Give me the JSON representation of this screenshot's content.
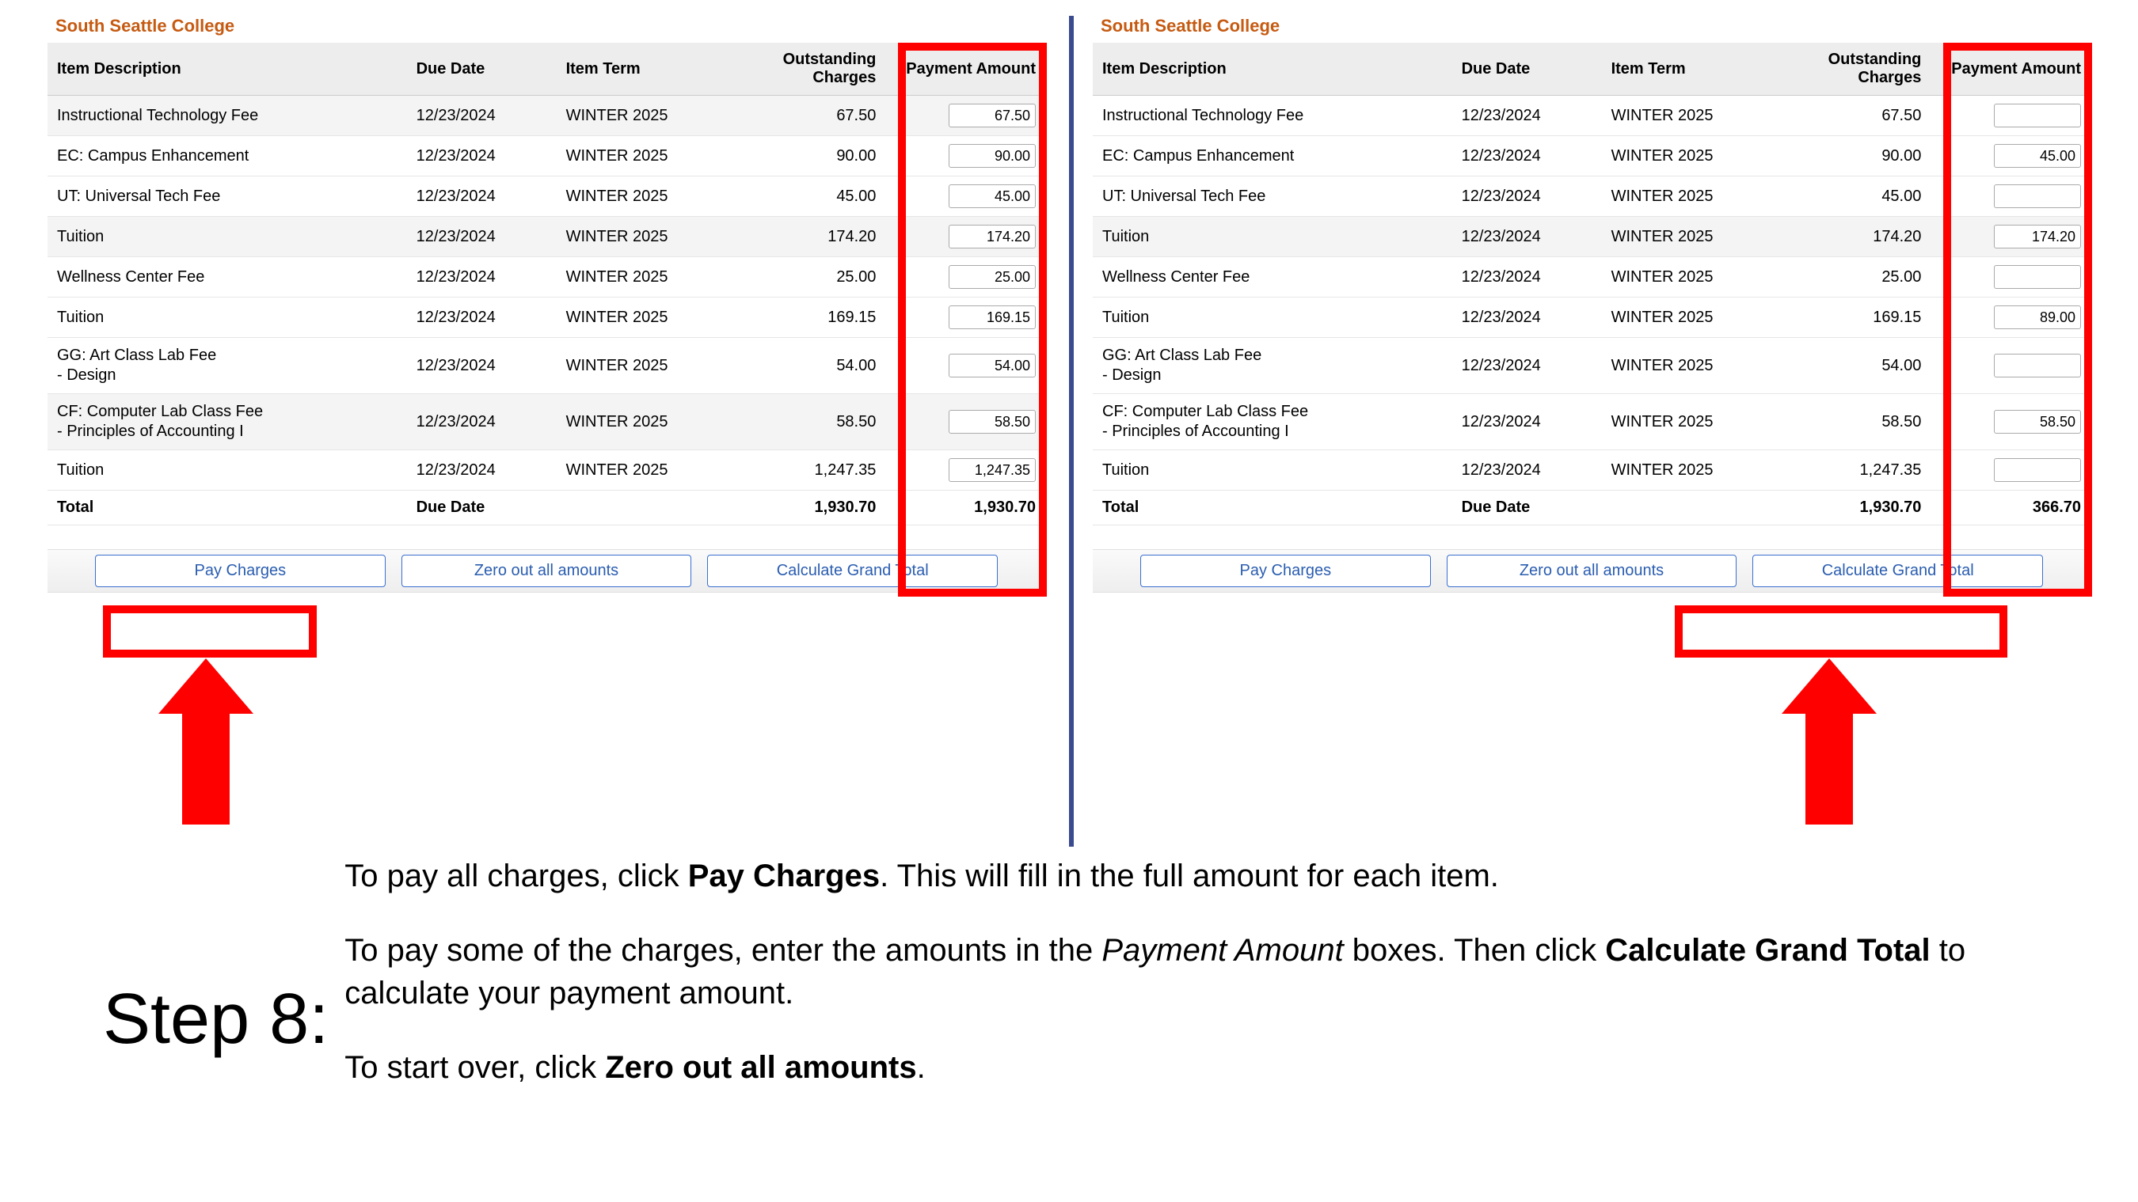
{
  "college_title": "South Seattle College",
  "headers": {
    "desc": "Item Description",
    "date": "Due Date",
    "term": "Item Term",
    "out_line1": "Outstanding",
    "out_line2": "Charges",
    "pay": "Payment Amount"
  },
  "left": {
    "rows": [
      {
        "desc": "Instructional Technology Fee",
        "date": "12/23/2024",
        "term": "WINTER 2025",
        "out": "67.50",
        "pay": "67.50",
        "alt": true
      },
      {
        "desc": "EC: Campus Enhancement",
        "date": "12/23/2024",
        "term": "WINTER 2025",
        "out": "90.00",
        "pay": "90.00",
        "alt": false
      },
      {
        "desc": "UT: Universal Tech Fee",
        "date": "12/23/2024",
        "term": "WINTER 2025",
        "out": "45.00",
        "pay": "45.00",
        "alt": false
      },
      {
        "desc": "Tuition",
        "date": "12/23/2024",
        "term": "WINTER 2025",
        "out": "174.20",
        "pay": "174.20",
        "alt": true
      },
      {
        "desc": "Wellness Center Fee",
        "date": "12/23/2024",
        "term": "WINTER 2025",
        "out": "25.00",
        "pay": "25.00",
        "alt": false
      },
      {
        "desc": "Tuition",
        "date": "12/23/2024",
        "term": "WINTER 2025",
        "out": "169.15",
        "pay": "169.15",
        "alt": false
      },
      {
        "desc": "GG: Art Class Lab Fee",
        "desc2": "-  Design",
        "date": "12/23/2024",
        "term": "WINTER 2025",
        "out": "54.00",
        "pay": "54.00",
        "alt": false
      },
      {
        "desc": "CF: Computer Lab Class Fee",
        "desc2": "-  Principles of Accounting I",
        "date": "12/23/2024",
        "term": "WINTER 2025",
        "out": "58.50",
        "pay": "58.50",
        "alt": true
      },
      {
        "desc": "Tuition",
        "date": "12/23/2024",
        "term": "WINTER 2025",
        "out": "1,247.35",
        "pay": "1,247.35",
        "alt": false
      }
    ],
    "total_label": "Total",
    "total_date": "Due Date",
    "total_out": "1,930.70",
    "total_pay": "1,930.70"
  },
  "right": {
    "rows": [
      {
        "desc": "Instructional Technology Fee",
        "date": "12/23/2024",
        "term": "WINTER 2025",
        "out": "67.50",
        "pay": "",
        "alt": false
      },
      {
        "desc": "EC: Campus Enhancement",
        "date": "12/23/2024",
        "term": "WINTER 2025",
        "out": "90.00",
        "pay": "45.00",
        "alt": false
      },
      {
        "desc": "UT: Universal Tech Fee",
        "date": "12/23/2024",
        "term": "WINTER 2025",
        "out": "45.00",
        "pay": "",
        "alt": false
      },
      {
        "desc": "Tuition",
        "date": "12/23/2024",
        "term": "WINTER 2025",
        "out": "174.20",
        "pay": "174.20",
        "alt": true
      },
      {
        "desc": "Wellness Center Fee",
        "date": "12/23/2024",
        "term": "WINTER 2025",
        "out": "25.00",
        "pay": "",
        "alt": false
      },
      {
        "desc": "Tuition",
        "date": "12/23/2024",
        "term": "WINTER 2025",
        "out": "169.15",
        "pay": "89.00",
        "alt": false
      },
      {
        "desc": "GG: Art Class Lab Fee",
        "desc2": "-  Design",
        "date": "12/23/2024",
        "term": "WINTER 2025",
        "out": "54.00",
        "pay": "",
        "alt": false
      },
      {
        "desc": "CF: Computer Lab Class Fee",
        "desc2": "-  Principles of Accounting I",
        "date": "12/23/2024",
        "term": "WINTER 2025",
        "out": "58.50",
        "pay": "58.50",
        "alt": false
      },
      {
        "desc": "Tuition",
        "date": "12/23/2024",
        "term": "WINTER 2025",
        "out": "1,247.35",
        "pay": "",
        "alt": false
      }
    ],
    "total_label": "Total",
    "total_date": "Due Date",
    "total_out": "1,930.70",
    "total_pay": "366.70"
  },
  "buttons": {
    "pay": "Pay Charges",
    "zero": "Zero out all amounts",
    "calc": "Calculate Grand Total"
  },
  "step_label": "Step 8:",
  "instr": {
    "p1_a": "To pay all charges, click ",
    "p1_b": "Pay Charges",
    "p1_c": ". This will fill in the full amount for each item.",
    "p2_a": "To pay some of the charges, enter the amounts in the ",
    "p2_b": "Payment Amount",
    "p2_c": " boxes. Then click ",
    "p2_d": "Calculate Grand Total",
    "p2_e": " to calculate your payment amount.",
    "p3_a": "To start over, click ",
    "p3_b": "Zero out all amounts",
    "p3_c": "."
  }
}
